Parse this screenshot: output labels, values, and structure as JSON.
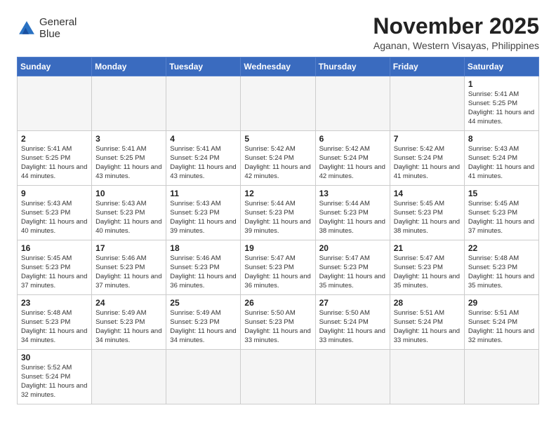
{
  "header": {
    "logo_line1": "General",
    "logo_line2": "Blue",
    "month_title": "November 2025",
    "location": "Aganan, Western Visayas, Philippines"
  },
  "weekdays": [
    "Sunday",
    "Monday",
    "Tuesday",
    "Wednesday",
    "Thursday",
    "Friday",
    "Saturday"
  ],
  "weeks": [
    [
      {
        "day": "",
        "detail": ""
      },
      {
        "day": "",
        "detail": ""
      },
      {
        "day": "",
        "detail": ""
      },
      {
        "day": "",
        "detail": ""
      },
      {
        "day": "",
        "detail": ""
      },
      {
        "day": "",
        "detail": ""
      },
      {
        "day": "1",
        "detail": "Sunrise: 5:41 AM\nSunset: 5:25 PM\nDaylight: 11 hours\nand 44 minutes."
      }
    ],
    [
      {
        "day": "2",
        "detail": "Sunrise: 5:41 AM\nSunset: 5:25 PM\nDaylight: 11 hours\nand 44 minutes."
      },
      {
        "day": "3",
        "detail": "Sunrise: 5:41 AM\nSunset: 5:25 PM\nDaylight: 11 hours\nand 43 minutes."
      },
      {
        "day": "4",
        "detail": "Sunrise: 5:41 AM\nSunset: 5:24 PM\nDaylight: 11 hours\nand 43 minutes."
      },
      {
        "day": "5",
        "detail": "Sunrise: 5:42 AM\nSunset: 5:24 PM\nDaylight: 11 hours\nand 42 minutes."
      },
      {
        "day": "6",
        "detail": "Sunrise: 5:42 AM\nSunset: 5:24 PM\nDaylight: 11 hours\nand 42 minutes."
      },
      {
        "day": "7",
        "detail": "Sunrise: 5:42 AM\nSunset: 5:24 PM\nDaylight: 11 hours\nand 41 minutes."
      },
      {
        "day": "8",
        "detail": "Sunrise: 5:43 AM\nSunset: 5:24 PM\nDaylight: 11 hours\nand 41 minutes."
      }
    ],
    [
      {
        "day": "9",
        "detail": "Sunrise: 5:43 AM\nSunset: 5:23 PM\nDaylight: 11 hours\nand 40 minutes."
      },
      {
        "day": "10",
        "detail": "Sunrise: 5:43 AM\nSunset: 5:23 PM\nDaylight: 11 hours\nand 40 minutes."
      },
      {
        "day": "11",
        "detail": "Sunrise: 5:43 AM\nSunset: 5:23 PM\nDaylight: 11 hours\nand 39 minutes."
      },
      {
        "day": "12",
        "detail": "Sunrise: 5:44 AM\nSunset: 5:23 PM\nDaylight: 11 hours\nand 39 minutes."
      },
      {
        "day": "13",
        "detail": "Sunrise: 5:44 AM\nSunset: 5:23 PM\nDaylight: 11 hours\nand 38 minutes."
      },
      {
        "day": "14",
        "detail": "Sunrise: 5:45 AM\nSunset: 5:23 PM\nDaylight: 11 hours\nand 38 minutes."
      },
      {
        "day": "15",
        "detail": "Sunrise: 5:45 AM\nSunset: 5:23 PM\nDaylight: 11 hours\nand 37 minutes."
      }
    ],
    [
      {
        "day": "16",
        "detail": "Sunrise: 5:45 AM\nSunset: 5:23 PM\nDaylight: 11 hours\nand 37 minutes."
      },
      {
        "day": "17",
        "detail": "Sunrise: 5:46 AM\nSunset: 5:23 PM\nDaylight: 11 hours\nand 37 minutes."
      },
      {
        "day": "18",
        "detail": "Sunrise: 5:46 AM\nSunset: 5:23 PM\nDaylight: 11 hours\nand 36 minutes."
      },
      {
        "day": "19",
        "detail": "Sunrise: 5:47 AM\nSunset: 5:23 PM\nDaylight: 11 hours\nand 36 minutes."
      },
      {
        "day": "20",
        "detail": "Sunrise: 5:47 AM\nSunset: 5:23 PM\nDaylight: 11 hours\nand 35 minutes."
      },
      {
        "day": "21",
        "detail": "Sunrise: 5:47 AM\nSunset: 5:23 PM\nDaylight: 11 hours\nand 35 minutes."
      },
      {
        "day": "22",
        "detail": "Sunrise: 5:48 AM\nSunset: 5:23 PM\nDaylight: 11 hours\nand 35 minutes."
      }
    ],
    [
      {
        "day": "23",
        "detail": "Sunrise: 5:48 AM\nSunset: 5:23 PM\nDaylight: 11 hours\nand 34 minutes."
      },
      {
        "day": "24",
        "detail": "Sunrise: 5:49 AM\nSunset: 5:23 PM\nDaylight: 11 hours\nand 34 minutes."
      },
      {
        "day": "25",
        "detail": "Sunrise: 5:49 AM\nSunset: 5:23 PM\nDaylight: 11 hours\nand 34 minutes."
      },
      {
        "day": "26",
        "detail": "Sunrise: 5:50 AM\nSunset: 5:23 PM\nDaylight: 11 hours\nand 33 minutes."
      },
      {
        "day": "27",
        "detail": "Sunrise: 5:50 AM\nSunset: 5:24 PM\nDaylight: 11 hours\nand 33 minutes."
      },
      {
        "day": "28",
        "detail": "Sunrise: 5:51 AM\nSunset: 5:24 PM\nDaylight: 11 hours\nand 33 minutes."
      },
      {
        "day": "29",
        "detail": "Sunrise: 5:51 AM\nSunset: 5:24 PM\nDaylight: 11 hours\nand 32 minutes."
      }
    ],
    [
      {
        "day": "30",
        "detail": "Sunrise: 5:52 AM\nSunset: 5:24 PM\nDaylight: 11 hours\nand 32 minutes."
      },
      {
        "day": "",
        "detail": ""
      },
      {
        "day": "",
        "detail": ""
      },
      {
        "day": "",
        "detail": ""
      },
      {
        "day": "",
        "detail": ""
      },
      {
        "day": "",
        "detail": ""
      },
      {
        "day": "",
        "detail": ""
      }
    ]
  ]
}
